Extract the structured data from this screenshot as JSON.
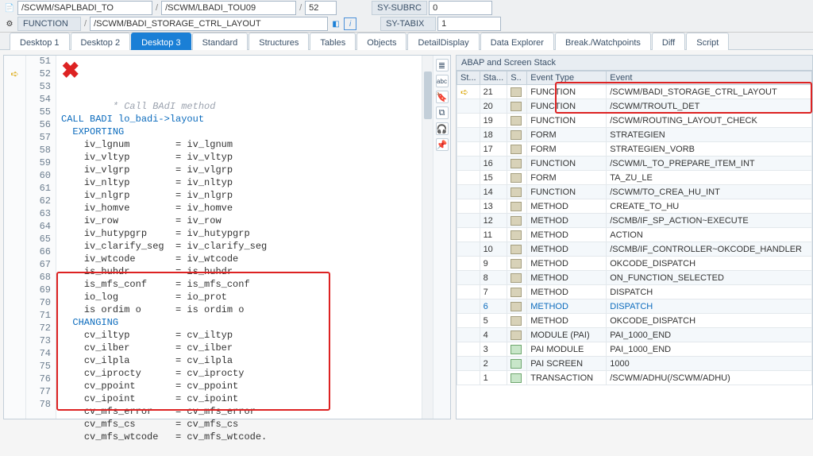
{
  "toolbar": {
    "row1": {
      "f1": "/SCWM/SAPLBADI_TO",
      "f2": "/SCWM/LBADI_TOU09",
      "f3": "52",
      "sy_subrc_label": "SY-SUBRC",
      "sy_subrc_val": "0"
    },
    "row2": {
      "type_label": "FUNCTION",
      "prog": "/SCWM/BADI_STORAGE_CTRL_LAYOUT",
      "sy_tabix_label": "SY-TABIX",
      "sy_tabix_val": "1"
    }
  },
  "tabs": [
    "Desktop 1",
    "Desktop 2",
    "Desktop 3",
    "Standard",
    "Structures",
    "Tables",
    "Objects",
    "DetailDisplay",
    "Data Explorer",
    "Break./Watchpoints",
    "Diff",
    "Script"
  ],
  "active_tab_index": 2,
  "code": {
    "first_line": 51,
    "lines": [
      {
        "c1": "         ",
        "c2": "Call BAdI method",
        "cls": "c"
      },
      {
        "c1": "",
        "c2": "CALL BADI lo_badi->layout",
        "cls": "k"
      },
      {
        "c1": "  ",
        "c2": "EXPORTING",
        "cls": "k"
      },
      {
        "c1": "    ",
        "c2": "iv_lgnum        = iv_lgnum"
      },
      {
        "c1": "    ",
        "c2": "iv_vltyp        = iv_vltyp"
      },
      {
        "c1": "    ",
        "c2": "iv_vlgrp        = iv_vlgrp"
      },
      {
        "c1": "    ",
        "c2": "iv_nltyp        = iv_nltyp"
      },
      {
        "c1": "    ",
        "c2": "iv_nlgrp        = iv_nlgrp"
      },
      {
        "c1": "    ",
        "c2": "iv_homve        = iv_homve"
      },
      {
        "c1": "    ",
        "c2": "iv_row          = iv_row"
      },
      {
        "c1": "    ",
        "c2": "iv_hutypgrp     = iv_hutypgrp"
      },
      {
        "c1": "    ",
        "c2": "iv_clarify_seg  = iv_clarify_seg"
      },
      {
        "c1": "    ",
        "c2": "iv_wtcode       = iv_wtcode"
      },
      {
        "c1": "    ",
        "c2": "is_huhdr        = is_huhdr"
      },
      {
        "c1": "    ",
        "c2": "is_mfs_conf     = is_mfs_conf"
      },
      {
        "c1": "    ",
        "c2": "io_log          = io_prot"
      },
      {
        "c1": "    ",
        "c2": "is ordim o      = is ordim o"
      },
      {
        "c1": "  ",
        "c2": "CHANGING",
        "cls": "k"
      },
      {
        "c1": "    ",
        "c2": "cv_iltyp        = cv_iltyp"
      },
      {
        "c1": "    ",
        "c2": "cv_ilber        = cv_ilber"
      },
      {
        "c1": "    ",
        "c2": "cv_ilpla        = cv_ilpla"
      },
      {
        "c1": "    ",
        "c2": "cv_iprocty      = cv_iprocty"
      },
      {
        "c1": "    ",
        "c2": "cv_ppoint       = cv_ppoint"
      },
      {
        "c1": "    ",
        "c2": "cv_ipoint       = cv_ipoint"
      },
      {
        "c1": "    ",
        "c2": "cv_mfs_error    = cv_mfs_error"
      },
      {
        "c1": "    ",
        "c2": "cv_mfs_cs       = cv_mfs_cs"
      },
      {
        "c1": "    ",
        "c2": "cv_mfs_wtcode   = cv_mfs_wtcode."
      },
      {
        "c1": "",
        "c2": ""
      }
    ]
  },
  "stack": {
    "title": "ABAP and Screen Stack",
    "headers": [
      "St...",
      "Sta...",
      "S..",
      "Event Type",
      "Event"
    ],
    "rows": [
      {
        "lvl": "21",
        "ind": "➪",
        "type": "FUNCTION",
        "event": "/SCWM/BADI_STORAGE_CTRL_LAYOUT"
      },
      {
        "lvl": "20",
        "ind": "",
        "type": "FUNCTION",
        "event": "/SCWM/TROUTL_DET"
      },
      {
        "lvl": "19",
        "ind": "",
        "type": "FUNCTION",
        "event": "/SCWM/ROUTING_LAYOUT_CHECK"
      },
      {
        "lvl": "18",
        "ind": "",
        "type": "FORM",
        "event": "STRATEGIEN"
      },
      {
        "lvl": "17",
        "ind": "",
        "type": "FORM",
        "event": "STRATEGIEN_VORB"
      },
      {
        "lvl": "16",
        "ind": "",
        "type": "FUNCTION",
        "event": "/SCWM/L_TO_PREPARE_ITEM_INT"
      },
      {
        "lvl": "15",
        "ind": "",
        "type": "FORM",
        "event": "TA_ZU_LE"
      },
      {
        "lvl": "14",
        "ind": "",
        "type": "FUNCTION",
        "event": "/SCWM/TO_CREA_HU_INT"
      },
      {
        "lvl": "13",
        "ind": "",
        "type": "METHOD",
        "event": "CREATE_TO_HU"
      },
      {
        "lvl": "12",
        "ind": "",
        "type": "METHOD",
        "event": "/SCMB/IF_SP_ACTION~EXECUTE"
      },
      {
        "lvl": "11",
        "ind": "",
        "type": "METHOD",
        "event": "ACTION"
      },
      {
        "lvl": "10",
        "ind": "",
        "type": "METHOD",
        "event": "/SCMB/IF_CONTROLLER~OKCODE_HANDLER"
      },
      {
        "lvl": "9",
        "ind": "",
        "type": "METHOD",
        "event": "OKCODE_DISPATCH"
      },
      {
        "lvl": "8",
        "ind": "",
        "type": "METHOD",
        "event": "ON_FUNCTION_SELECTED"
      },
      {
        "lvl": "7",
        "ind": "",
        "type": "METHOD",
        "event": "DISPATCH"
      },
      {
        "lvl": "6",
        "ind": "",
        "type": "METHOD",
        "event": "DISPATCH",
        "sel": true
      },
      {
        "lvl": "5",
        "ind": "",
        "type": "METHOD",
        "event": "OKCODE_DISPATCH"
      },
      {
        "lvl": "4",
        "ind": "",
        "type": "MODULE (PAI)",
        "event": "PAI_1000_END"
      },
      {
        "lvl": "3",
        "ind": "",
        "type": "PAI MODULE",
        "event": "PAI_1000_END",
        "green": true
      },
      {
        "lvl": "2",
        "ind": "",
        "type": "PAI SCREEN",
        "event": "1000",
        "green": true
      },
      {
        "lvl": "1",
        "ind": "",
        "type": "TRANSACTION",
        "event": "/SCWM/ADHU(/SCWM/ADHU)",
        "green": true
      }
    ]
  }
}
